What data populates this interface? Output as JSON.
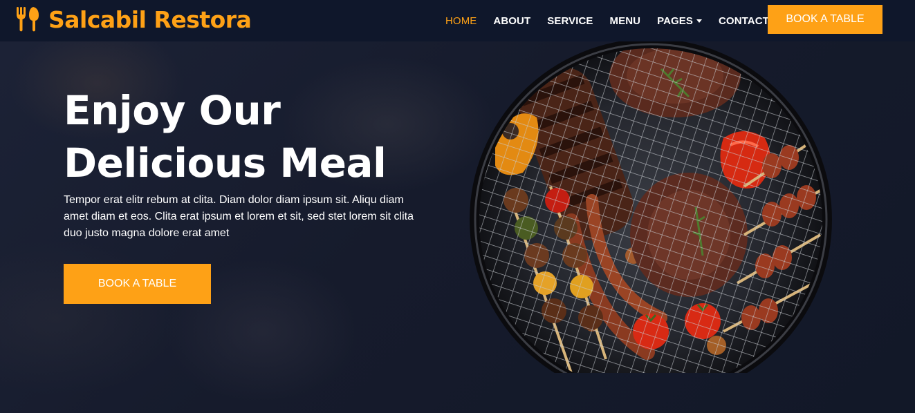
{
  "brand": {
    "name": "Salcabil Restora",
    "icon": "utensils-icon",
    "color": "#fea116"
  },
  "nav": {
    "items": [
      {
        "label": "Home",
        "active": true
      },
      {
        "label": "About"
      },
      {
        "label": "Service"
      },
      {
        "label": "Menu"
      },
      {
        "label": "Pages",
        "dropdown": true
      },
      {
        "label": "Contact"
      }
    ],
    "cta": "Book A Table"
  },
  "hero": {
    "title_line1": "Enjoy Our",
    "title_line2": "Delicious Meal",
    "text": "Tempor erat elitr rebum at clita. Diam dolor diam ipsum sit. Aliqu diam amet diam et eos. Clita erat ipsum et lorem et sit, sed stet lorem sit clita duo justo magna dolore erat amet",
    "cta": "Book A Table",
    "image": "grilled-meat-barbecue-image"
  },
  "colors": {
    "accent": "#fea116",
    "navbar_bg": "#0f172b",
    "hero_bg": "#161b2c"
  }
}
